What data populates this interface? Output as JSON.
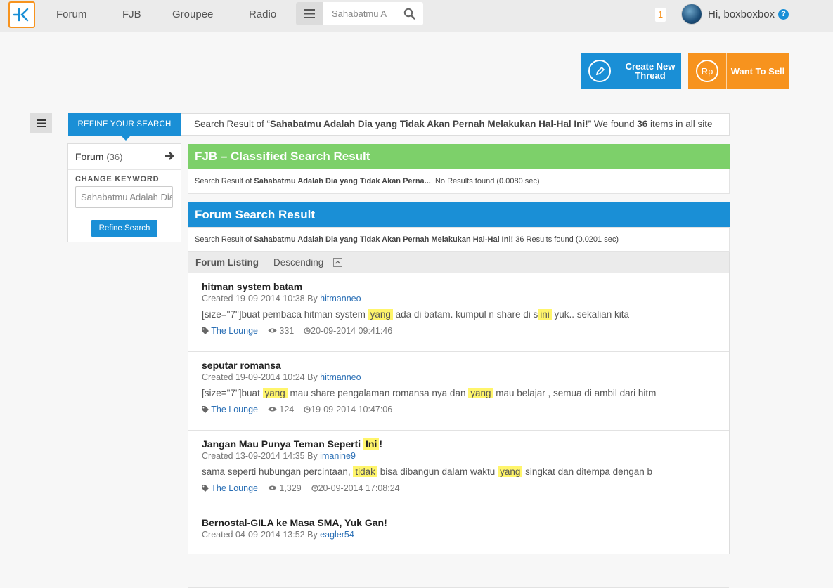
{
  "nav": {
    "forum": "Forum",
    "fjb": "FJB",
    "groupee": "Groupee",
    "radio": "Radio"
  },
  "search": {
    "value": "Sahabatmu A"
  },
  "user": {
    "notifications": "1",
    "greeting": "Hi, boxboxbox",
    "help": "?"
  },
  "actions": {
    "create_thread": "Create New Thread",
    "want_to_sell": "Want To Sell",
    "sell_icon_text": "Rp"
  },
  "refine": {
    "tab_label": "REFINE YOUR SEARCH",
    "summary_prefix": "Search Result of “",
    "summary_query": "Sahabatmu Adalah Dia yang Tidak Akan Pernah Melakukan Hal-Hal Ini!",
    "summary_mid": "” We found ",
    "summary_count": "36",
    "summary_suffix": " items in all site"
  },
  "filter": {
    "forum_label": "Forum",
    "forum_count": "(36)",
    "change_keyword": "CHANGE KEYWORD",
    "keyword_value": "Sahabatmu Adalah Dia",
    "refine_button": "Refine Search"
  },
  "fjb": {
    "title": "FJB – Classified Search Result",
    "prefix": "Search Result of ",
    "query": "Sahabatmu Adalah Dia yang Tidak Akan Perna...",
    "result": "No Results found (0.0080 sec)"
  },
  "forum_result": {
    "title": "Forum Search Result",
    "prefix": "Search Result of ",
    "query": "Sahabatmu Adalah Dia yang Tidak Akan Pernah Melakukan Hal-Hal Ini!",
    "result": " 36 Results found (0.0201 sec)"
  },
  "listing": {
    "label": "Forum Listing",
    "order": " — Descending"
  },
  "threads": [
    {
      "title": "hitman system batam",
      "created": "Created 19-09-2014 10:38 By ",
      "author": "hitmanneo",
      "snippet": [
        {
          "t": "[size=\"7\"]buat pembaca hitman system ",
          "hl": false
        },
        {
          "t": "yang",
          "hl": true
        },
        {
          "t": " ada di batam. kumpul n share di s",
          "hl": false
        },
        {
          "t": "ini",
          "hl": true
        },
        {
          "t": " yuk.. sekalian kita",
          "hl": false
        }
      ],
      "tag": "The Lounge",
      "views": "331",
      "last": "20-09-2014 09:41:46"
    },
    {
      "title": "seputar romansa",
      "created": "Created 19-09-2014 10:24 By ",
      "author": "hitmanneo",
      "snippet": [
        {
          "t": "[size=\"7\"]buat ",
          "hl": false
        },
        {
          "t": "yang",
          "hl": true
        },
        {
          "t": " mau share pengalaman romansa nya dan ",
          "hl": false
        },
        {
          "t": "yang",
          "hl": true
        },
        {
          "t": " mau belajar , semua di ambil dari hitm",
          "hl": false
        }
      ],
      "tag": "The Lounge",
      "views": "124",
      "last": "19-09-2014 10:47:06"
    },
    {
      "title_parts": [
        {
          "t": "Jangan Mau Punya Teman Seperti ",
          "hl": false
        },
        {
          "t": "Ini",
          "hl": true
        },
        {
          "t": "!",
          "hl": false
        }
      ],
      "created": "Created 13-09-2014 14:35 By ",
      "author": "imanine9",
      "snippet": [
        {
          "t": "sama seperti hubungan percintaan, ",
          "hl": false
        },
        {
          "t": "tidak",
          "hl": true
        },
        {
          "t": " bisa dibangun dalam waktu ",
          "hl": false
        },
        {
          "t": "yang",
          "hl": true
        },
        {
          "t": " singkat dan ditempa dengan b",
          "hl": false
        }
      ],
      "tag": "The Lounge",
      "views": "1,329",
      "last": "20-09-2014 17:08:24"
    },
    {
      "title": "Bernostal-GILA ke Masa SMA, Yuk Gan!",
      "created": "Created 04-09-2014 13:52 By ",
      "author": "eagler54"
    }
  ],
  "colors": {
    "blue": "#1a8fd6",
    "orange": "#f7931e",
    "green": "#7dd06a",
    "highlight": "#fff56b"
  }
}
